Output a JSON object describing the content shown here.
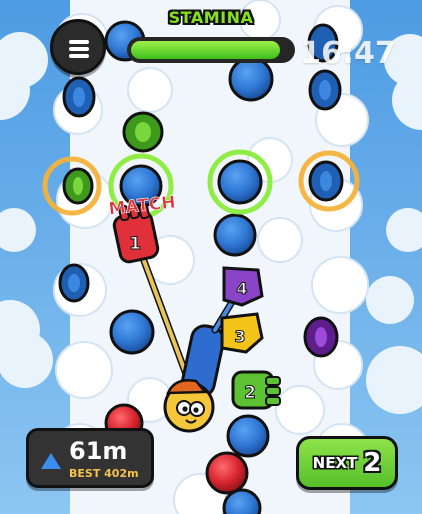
{
  "hud": {
    "stamina_label": "STAMINA",
    "stamina_level": 0.93,
    "timer": "16:47",
    "menu_icon": "hamburger-menu-icon"
  },
  "height": {
    "current": "61m",
    "best": "BEST 402m",
    "arrow_icon": "up-arrow-icon"
  },
  "next": {
    "label": "NEXT",
    "count": "2"
  },
  "scene": {
    "match_text": "MATCH",
    "limbs": [
      {
        "limb": "left-hand",
        "number": "1",
        "color": "#e0303a"
      },
      {
        "limb": "right-hand",
        "number": "2",
        "color": "#5cc234"
      },
      {
        "limb": "right-foot",
        "number": "3",
        "color": "#f2c318"
      },
      {
        "limb": "left-foot",
        "number": "4",
        "color": "#8a44c8"
      }
    ]
  },
  "colors": {
    "sky": "#5ba4e6",
    "hold_blue": "#2f78d4",
    "hold_green": "#59c12c",
    "hold_red": "#d8262f",
    "hold_purple": "#7b2ab3",
    "highlight_green": "#8aec3c",
    "highlight_orange": "#f3b23a"
  }
}
